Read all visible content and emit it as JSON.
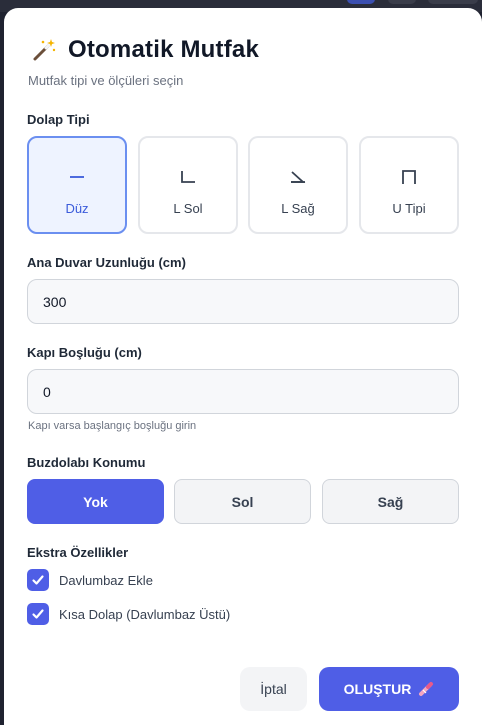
{
  "header": {
    "icon": "magic-wand-icon",
    "title": "Otomatik Mutfak",
    "subtitle": "Mutfak tipi ve ölçüleri seçin"
  },
  "cabinet_type": {
    "label": "Dolap Tipi",
    "options": [
      {
        "label": "Düz",
        "icon": "straight-line-icon",
        "selected": true
      },
      {
        "label": "L Sol",
        "icon": "l-left-icon",
        "selected": false
      },
      {
        "label": "L Sağ",
        "icon": "l-right-icon",
        "selected": false
      },
      {
        "label": "U Tipi",
        "icon": "u-shape-icon",
        "selected": false
      }
    ]
  },
  "wall_length": {
    "label": "Ana Duvar Uzunluğu (cm)",
    "value": "300"
  },
  "door_gap": {
    "label": "Kapı Boşluğu (cm)",
    "value": "0",
    "hint": "Kapı varsa başlangıç boşluğu girin"
  },
  "fridge_position": {
    "label": "Buzdolabı Konumu",
    "options": [
      {
        "label": "Yok",
        "selected": true
      },
      {
        "label": "Sol",
        "selected": false
      },
      {
        "label": "Sağ",
        "selected": false
      }
    ]
  },
  "extras": {
    "label": "Ekstra Özellikler",
    "items": [
      {
        "label": "Davlumbaz Ekle",
        "checked": true
      },
      {
        "label": "Kısa Dolap (Davlumbaz Üstü)",
        "checked": true
      }
    ]
  },
  "actions": {
    "cancel_label": "İptal",
    "create_label": "OLUŞTUR",
    "create_icon": "crayon-icon"
  },
  "colors": {
    "accent": "#4f5ee6",
    "selected_border": "#6b8ff0",
    "selected_bg": "#eef3ff"
  }
}
